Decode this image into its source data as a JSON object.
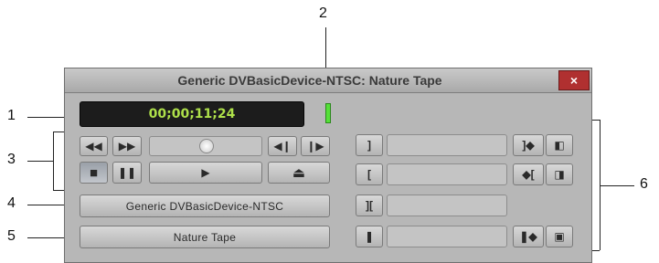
{
  "callouts": [
    "1",
    "2",
    "3",
    "4",
    "5",
    "6"
  ],
  "window": {
    "title": "Generic DVBasicDevice-NTSC: Nature Tape",
    "close_glyph": "×"
  },
  "timecode": "00;00;11;24",
  "device_name": "Generic DVBasicDevice-NTSC",
  "tape_name": "Nature Tape",
  "colors": {
    "timecode_text": "#aee04a",
    "status_led": "#55e038",
    "close_button": "#b03030",
    "panel": "#b7b7b7"
  },
  "icons": {
    "rewind": "◀◀",
    "fast_forward": "▶▶",
    "step_back": "◀❙",
    "step_forward": "❙▶",
    "stop": "■",
    "pause": "❚❚",
    "play": "▶",
    "eject": "⏏",
    "mark_out": "]",
    "mark_in": "[",
    "duration": "][",
    "audio": "❚",
    "go_to_out": "]◆",
    "out_clip": "◧",
    "go_to_in": "◆[",
    "in_clip": "◨",
    "go_to_audio": "❚◆",
    "audio_clip": "▣"
  }
}
